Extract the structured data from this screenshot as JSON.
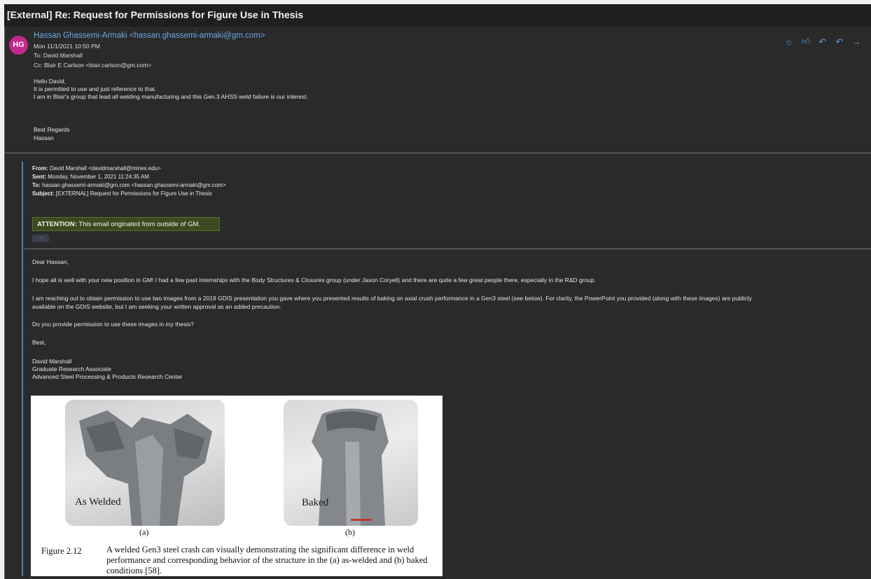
{
  "window": {
    "title": "[External] Re: Request for Permissions for Figure Use in Thesis"
  },
  "message": {
    "avatar_initials": "HG",
    "sender": "Hassan Ghassemi-Armaki <hassan.ghassemi-armaki@gm.com>",
    "date": "Mon 11/1/2021 10:50 PM",
    "to": "To:  David Marshall",
    "cc": "Cc:  Blair E Carlson <blair.carlson@gm.com>",
    "body": [
      "Hello David,",
      "It is permitted to use and just reference to that.",
      "I am in Blair's group that lead all welding manufacturing and this Gen.3 AHSS weld failure is our interest."
    ],
    "signoff": [
      "Best Regards",
      "Hassan"
    ],
    "actions": [
      {
        "icon": "sun-icon",
        "glyph": "☼"
      },
      {
        "icon": "like-icon",
        "glyph": "👍"
      },
      {
        "icon": "reply-icon",
        "glyph": "↶"
      },
      {
        "icon": "reply-all-icon",
        "glyph": "↶"
      },
      {
        "icon": "forward-icon",
        "glyph": "→"
      }
    ]
  },
  "quoted_header": {
    "from_label": "From:",
    "from": "David Marshall <davidmarshall@mines.edu>",
    "sent_label": "Sent:",
    "sent": "Monday, November 1, 2021 11:24:35 AM",
    "to_label": "To:",
    "to": "hassan.ghassemi-armaki@gm.com <hassan.ghassemi-armaki@gm.com>",
    "subject_label": "Subject:",
    "subject": "[EXTERNAL] Request for Permissions for Figure Use in Thesis"
  },
  "attention": {
    "label": "ATTENTION:",
    "text": "This email originated from outside of GM."
  },
  "expand_dots": "···",
  "quoted": {
    "greeting": "Dear Hassan,",
    "p1": "I hope all is well with your new position in GM! I had a few past internships with the Body Structures & Closures group (under Jason Coryell) and there are quite a few great people there, especially in the R&D group.",
    "p2a": "I am reaching out to obtain permission to use two images from a 2019 GDIS presentation you gave where you presented results of baking on axial crush performance in a Gen3 steel (see below). For clarity, the PowerPoint you provided (along with these images) are publicly",
    "p2b": "available on the GDIS website, but I am seeking your written approval as an added precaution.",
    "p3": "Do you provide permission to use these images in my thesis?",
    "closing": "Best,",
    "sig": [
      "David Marshall",
      "Graduate Research Associate",
      "Advanced Steel Processing & Products Research Center"
    ]
  },
  "figure": {
    "label_a": "As Welded",
    "label_b": "Baked",
    "sub_a": "(a)",
    "sub_b": "(b)",
    "number": "Figure 2.12",
    "caption": "A welded Gen3 steel crash can visually demonstrating the significant difference in weld performance and corresponding behavior of the structure in the (a) as-welded and (b) baked conditions [58]."
  }
}
